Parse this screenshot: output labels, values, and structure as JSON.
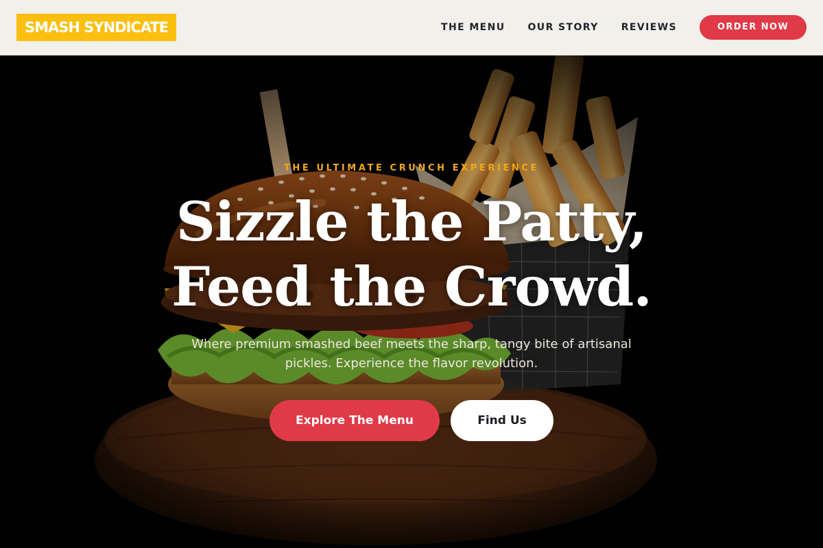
{
  "brand": {
    "logo_text": "SMASH SYNDICATE",
    "logo_bg": "#fbbf0f"
  },
  "nav": {
    "items": [
      {
        "label": "THE MENU"
      },
      {
        "label": "OUR STORY"
      },
      {
        "label": "REVIEWS"
      }
    ],
    "order_label": "ORDER NOW"
  },
  "hero": {
    "eyebrow": "THE ULTIMATE CRUNCH EXPERIENCE",
    "headline_line1": "Sizzle the Patty,",
    "headline_line2": "Feed the Crowd.",
    "subtitle": "Where premium smashed beef meets the sharp, tangy bite of artisanal pickles. Experience the flavor revolution.",
    "primary_cta": "Explore The Menu",
    "secondary_cta": "Find Us",
    "background_image": "burger-and-fries-on-wooden-board"
  },
  "colors": {
    "accent_red": "#e03a48",
    "accent_yellow": "#fbbf0f",
    "eyebrow_gold": "#f0a818",
    "nav_bg": "#f2f0eb",
    "hero_bg": "#020202"
  }
}
